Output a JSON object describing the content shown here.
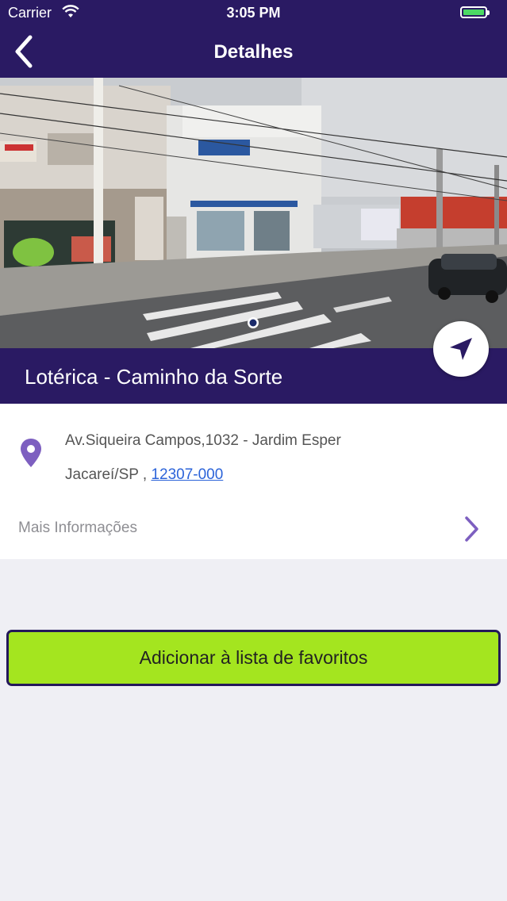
{
  "status_bar": {
    "carrier": "Carrier",
    "time": "3:05 PM",
    "wifi_icon": "wifi-icon",
    "battery_icon": "battery-icon",
    "battery_level": 1.0
  },
  "nav": {
    "title": "Detalhes",
    "back_icon": "chevron-left-icon"
  },
  "place": {
    "name": "Lotérica - Caminho da Sorte",
    "address_line1": "Av.Siqueira Campos,1032 - Jardim Esper",
    "city_state": "Jacareí/SP , ",
    "cep": "12307-000",
    "pin_icon": "map-pin-icon",
    "navigate_icon": "navigation-arrow-icon"
  },
  "more_info": {
    "label": "Mais Informações",
    "chevron_icon": "chevron-right-icon"
  },
  "actions": {
    "favorite_label": "Adicionar à lista de favoritos"
  },
  "colors": {
    "brand": "#2a1a63",
    "accent_button": "#a4e51f",
    "link": "#2b63d9",
    "icon_purple": "#7d5fc0",
    "battery": "#4cd964",
    "background": "#efeff4"
  }
}
